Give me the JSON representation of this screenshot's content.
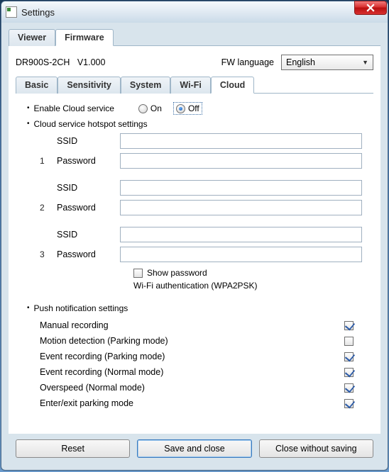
{
  "window": {
    "title": "Settings"
  },
  "top_tabs": {
    "viewer": "Viewer",
    "firmware": "Firmware",
    "active": "Firmware"
  },
  "fw": {
    "model": "DR900S-2CH",
    "version": "V1.000",
    "lang_label": "FW language",
    "lang_value": "English"
  },
  "sub_tabs": {
    "basic": "Basic",
    "sensitivity": "Sensitivity",
    "system": "System",
    "wifi": "Wi-Fi",
    "cloud": "Cloud",
    "active": "Cloud"
  },
  "cloud": {
    "enable_label": "Enable Cloud service",
    "on_label": "On",
    "off_label": "Off",
    "enabled": "Off",
    "hotspot_label": "Cloud service hotspot settings",
    "slots": [
      {
        "idx": "1",
        "ssid_label": "SSID",
        "ssid": "",
        "pw_label": "Password",
        "pw": ""
      },
      {
        "idx": "2",
        "ssid_label": "SSID",
        "ssid": "",
        "pw_label": "Password",
        "pw": ""
      },
      {
        "idx": "3",
        "ssid_label": "SSID",
        "ssid": "",
        "pw_label": "Password",
        "pw": ""
      }
    ],
    "show_pw_label": "Show password",
    "show_pw": false,
    "auth_note": "Wi-Fi authentication (WPA2PSK)"
  },
  "push": {
    "header": "Push notification settings",
    "items": [
      {
        "label": "Manual recording",
        "checked": true
      },
      {
        "label": "Motion detection (Parking mode)",
        "checked": false
      },
      {
        "label": "Event recording (Parking mode)",
        "checked": true
      },
      {
        "label": "Event recording (Normal mode)",
        "checked": true
      },
      {
        "label": "Overspeed (Normal mode)",
        "checked": true
      },
      {
        "label": "Enter/exit parking mode",
        "checked": true
      }
    ]
  },
  "buttons": {
    "reset": "Reset",
    "save": "Save and close",
    "cancel": "Close without saving"
  }
}
